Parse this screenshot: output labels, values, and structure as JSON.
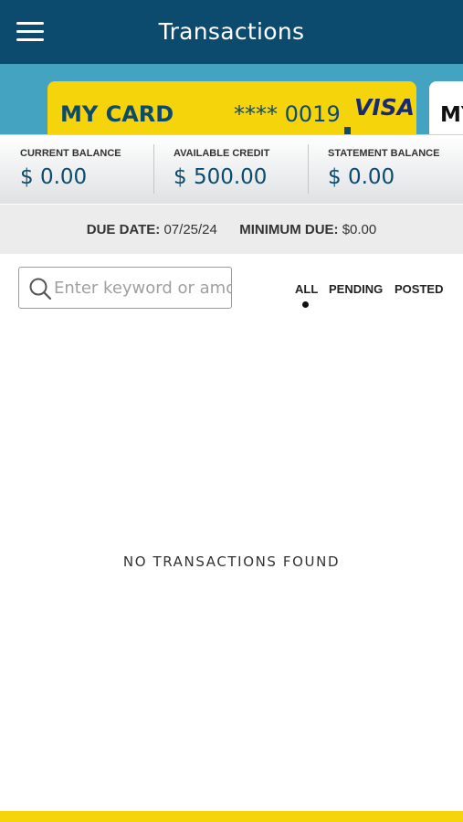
{
  "header": {
    "title": "Transactions",
    "menu_icon": "hamburger-menu-icon"
  },
  "card": {
    "name": "MY CARD",
    "number": "**** 0019",
    "network": "VISA",
    "next_card_name": "MY"
  },
  "balances": [
    {
      "label": "CURRENT BALANCE",
      "value": "$ 0.00"
    },
    {
      "label": "AVAILABLE CREDIT",
      "value": "$ 500.00"
    },
    {
      "label": "STATEMENT BALANCE",
      "value": "$ 0.00"
    }
  ],
  "due": {
    "date_label": "DUE DATE:",
    "date": "07/25/24",
    "min_label": "MINIMUM DUE:",
    "min_value": "$0.00"
  },
  "search": {
    "placeholder": "Enter keyword or amount",
    "icon": "search-icon"
  },
  "filters": {
    "all": "ALL",
    "pending": "PENDING",
    "posted": "POSTED",
    "active": "ALL"
  },
  "empty_message": "NO TRANSACTIONS FOUND",
  "colors": {
    "header": "#0c4b6e",
    "strip": "#45a3c2",
    "card": "#f6d40b",
    "accent_text": "#0c4b6e"
  }
}
